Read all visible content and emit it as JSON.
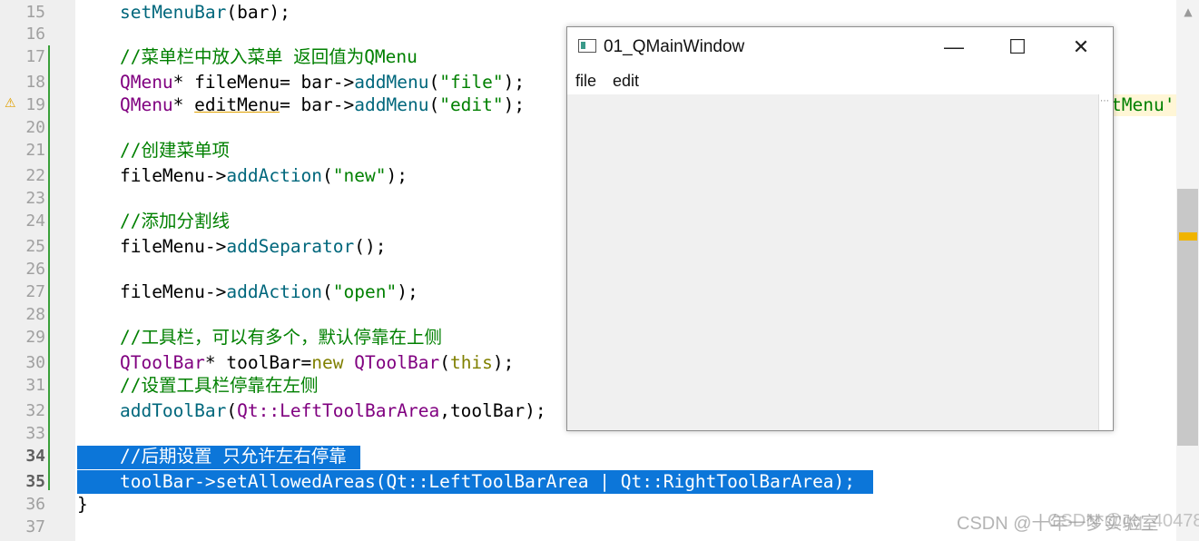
{
  "editor": {
    "line_numbers": [
      "15",
      "16",
      "17",
      "18",
      "19",
      "20",
      "21",
      "22",
      "23",
      "24",
      "25",
      "26",
      "27",
      "28",
      "29",
      "30",
      "31",
      "32",
      "33",
      "34",
      "35",
      "36",
      "37"
    ],
    "warning_marker": "⚠",
    "lines": {
      "l15": {
        "fn": "setMenuBar",
        "rest": "(bar);"
      },
      "l17": {
        "comment": "//菜单栏中放入菜单 返回值为QMenu"
      },
      "l18": {
        "type": "QMenu",
        "a": "* fileMenu= bar->",
        "fn": "addMenu",
        "b": "(",
        "str": "\"file\"",
        "c": ");"
      },
      "l19": {
        "type": "QMenu",
        "a": "* ",
        "warn": "editMenu",
        "b": "= bar->",
        "fn": "addMenu",
        "c": "(",
        "str": "\"edit\"",
        "d": ");"
      },
      "l21": {
        "comment": "//创建菜单项"
      },
      "l22": {
        "a": "fileMenu->",
        "fn": "addAction",
        "b": "(",
        "str": "\"new\"",
        "c": ");"
      },
      "l24": {
        "comment": "//添加分割线"
      },
      "l25": {
        "a": "fileMenu->",
        "fn": "addSeparator",
        "b": "();"
      },
      "l27": {
        "a": "fileMenu->",
        "fn": "addAction",
        "b": "(",
        "str": "\"open\"",
        "c": ");"
      },
      "l29": {
        "comment": "//工具栏，可以有多个，默认停靠在上侧"
      },
      "l30": {
        "type": "QToolBar",
        "a": "* toolBar=",
        "kw": "new",
        "b": " ",
        "type2": "QToolBar",
        "c": "(",
        "kw2": "this",
        "d": ");"
      },
      "l31": {
        "comment": "//设置工具栏停靠在左侧"
      },
      "l32": {
        "fn": "addToolBar",
        "a": "(",
        "type": "Qt::",
        "enum": "LeftToolBarArea",
        "b": ",toolBar);"
      },
      "l34": {
        "comment": "//后期设置 只允许左右停靠"
      },
      "l35": {
        "text": "toolBar->setAllowedAreas(Qt::LeftToolBarArea | Qt::RightToolBarArea);"
      },
      "l36": {
        "text": "}"
      }
    },
    "partial_text": "tMenu'"
  },
  "window": {
    "title": "01_QMainWindow",
    "minimize_glyph": "—",
    "maximize_glyph": "☐",
    "close_glyph": "✕",
    "menu": [
      "file",
      "edit"
    ],
    "grip_glyph": "⋯"
  },
  "scrollbar": {
    "up_arrow": "▲",
    "marker_color": "#f0b400"
  },
  "watermark": {
    "text": "CSDN @十年一梦实验室",
    "overlap_text": "CSDN @qq_40478082"
  },
  "colors": {
    "selection": "#0c76d9",
    "comment": "#008000",
    "function": "#00677c",
    "type": "#800080",
    "keyword": "#808000"
  }
}
